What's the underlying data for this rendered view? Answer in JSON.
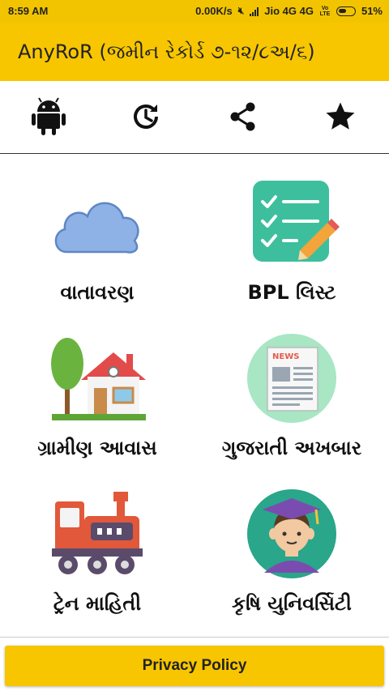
{
  "status_bar": {
    "time": "8:59 AM",
    "net_speed": "0.00K/s",
    "carrier": "Jio 4G 4G",
    "volte": "Vo LTE",
    "battery": "51%"
  },
  "app_bar": {
    "title": "AnyRoR (જમીન રેકોર્ડ ૭-૧૨/૮અ/૬)"
  },
  "toolbar": {
    "icons": [
      "android-icon",
      "history-icon",
      "share-icon",
      "star-icon"
    ]
  },
  "tiles": [
    {
      "label": "વાતાવરણ",
      "icon": "cloud-icon"
    },
    {
      "label": "BPL લિસ્ટ",
      "icon": "checklist-icon"
    },
    {
      "label": "ગ્રામીણ આવાસ",
      "icon": "house-icon"
    },
    {
      "label": "ગુજરાતી અખબાર",
      "icon": "newspaper-icon"
    },
    {
      "label": "ટ્રેન માહિતી",
      "icon": "train-icon"
    },
    {
      "label": "કૃષિ યુનિવર્સિટી",
      "icon": "graduate-icon"
    }
  ],
  "footer": {
    "privacy_label": "Privacy Policy"
  },
  "colors": {
    "accent": "#f7c600",
    "status_bar": "#f2c400"
  }
}
